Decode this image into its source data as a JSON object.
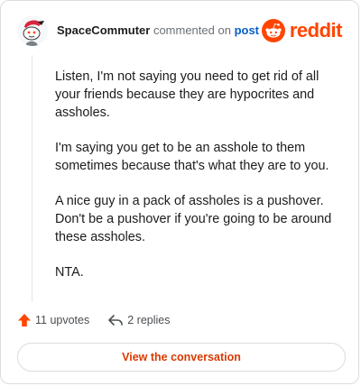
{
  "header": {
    "username": "SpaceCommuter",
    "action_text": "commented on",
    "post_link_text": "post",
    "logo_text": "reddit"
  },
  "comment": {
    "paragraphs": [
      "Listen, I'm not saying you need to get rid of all your friends because they are hypocrites and assholes.",
      "I'm saying you get to be an asshole to them sometimes because that's what they are to you.",
      "A nice guy in a pack of assholes is a pushover. Don't be a pushover if you're going to be around these assholes.",
      "NTA."
    ]
  },
  "footer": {
    "upvotes_label": "11 upvotes",
    "replies_label": "2 replies",
    "cta_label": "View the conversation"
  },
  "colors": {
    "brand": "#ff4500",
    "cta_text": "#d93a00",
    "link": "#0a5ec7"
  },
  "icons": [
    "avatar",
    "reddit-snoo-icon",
    "upvote-arrow-icon",
    "reply-arrow-icon"
  ]
}
